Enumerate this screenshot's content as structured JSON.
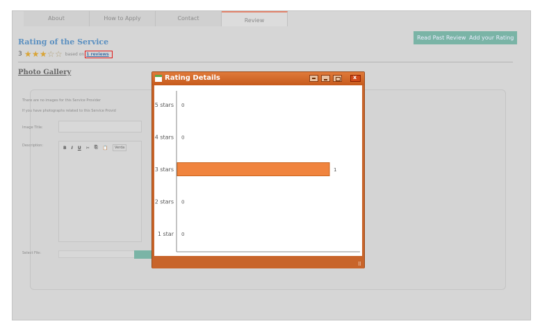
{
  "tabs": [
    "About",
    "How to Apply",
    "Contact",
    "Review"
  ],
  "rating": {
    "title": "Rating of the Service",
    "value": "3",
    "stars_filled": 3,
    "stars_total": 5,
    "based_on": "based on",
    "reviews_link": "1 reviews"
  },
  "buttons": {
    "read_past": "Read Past Review",
    "add_rating": "Add your Rating"
  },
  "gallery": {
    "title": "Photo Gallery",
    "note1": "There are no images for this Service Provider",
    "note2": "If you have photographs related to this Service Provid",
    "image_title_label": "Image Title:",
    "description_label": "Description:",
    "editor_tools": [
      "B",
      "I",
      "U",
      "✂",
      "⎘",
      "📋"
    ],
    "editor_font": "Verda",
    "select_file_label": "Select File:"
  },
  "modal": {
    "title": "Rating Details"
  },
  "colors": {
    "accent": "#7ab4a6",
    "bar": "#f0843e",
    "modal": "#c8642a"
  },
  "chart_data": {
    "type": "bar",
    "orientation": "horizontal",
    "categories": [
      "5 stars",
      "4 stars",
      "3 stars",
      "2 stars",
      "1 star"
    ],
    "values": [
      0,
      0,
      1,
      0,
      0
    ],
    "value_labels": [
      "0",
      "0",
      "1",
      "0",
      "0"
    ],
    "xlim": [
      0,
      1
    ]
  }
}
